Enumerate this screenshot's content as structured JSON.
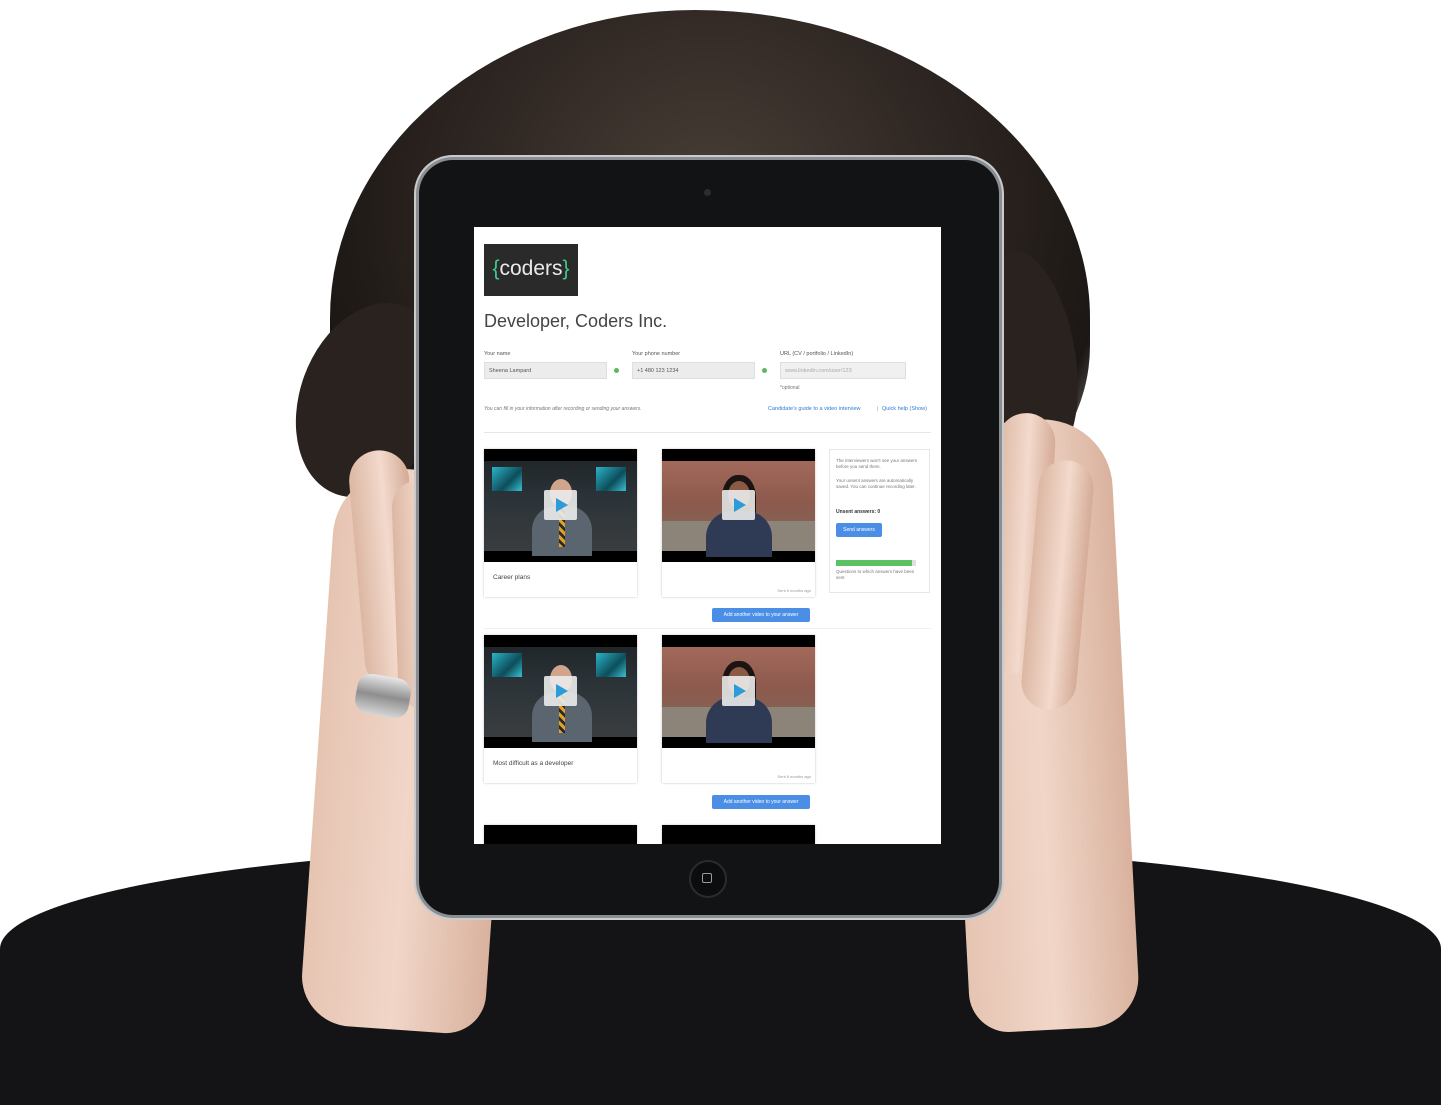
{
  "app": {
    "logo_text": "coders",
    "logo_brace_open": "{",
    "logo_brace_close": "}",
    "page_title": "Developer, Coders Inc."
  },
  "form": {
    "name_label": "Your name",
    "name_value": "Sheena Lampard",
    "phone_label": "Your phone number",
    "phone_value": "+1 480 123 1234",
    "url_label": "URL (CV / portfolio / LinkedIn)",
    "url_placeholder": "www.linkedin.com/user/123",
    "url_hint": "*optional",
    "fill_note": "You can fill in your information after recording or sending your answers.",
    "guide_link": "Candidate's guide to a video interview",
    "link_separator": "|",
    "help_link": "Quick help (Show)"
  },
  "questions": [
    {
      "title": "Career plans",
      "sent_meta": "Sent 6 months ago",
      "add_button": "Add another video to your answer"
    },
    {
      "title": "Most difficult as a developer",
      "sent_meta": "Sent 6 months ago",
      "add_button": "Add another video to your answer"
    }
  ],
  "sidebar": {
    "notice_1": "The interviewers won't see your answers before you send them.",
    "notice_2": "Your unsent answers are automatically saved. You can continue recording later.",
    "unsent_label": "Unsent answers: 0",
    "send_button": "Send answers",
    "progress_caption": "Questions to which answers have been sent",
    "progress_fraction": 0.95
  },
  "colors": {
    "accent_blue": "#4a8ee6",
    "play_blue": "#2b9bd9",
    "success_green": "#5cb85c",
    "brace_green": "#3ecb8a"
  },
  "icons": {
    "status": "check-dot-icon",
    "video": "play-icon",
    "home": "home-button-icon"
  }
}
